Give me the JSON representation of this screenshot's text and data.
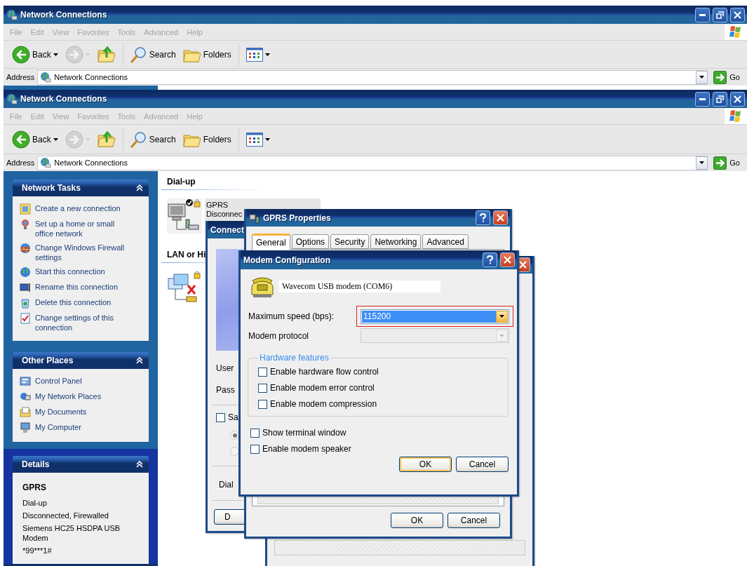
{
  "windows": [
    {
      "title": "Network Connections",
      "menu": [
        {
          "label": "File",
          "disabled": true
        },
        {
          "label": "Edit",
          "disabled": true
        },
        {
          "label": "View",
          "disabled": true
        },
        {
          "label": "Favorites",
          "disabled": true
        },
        {
          "label": "Tools",
          "disabled": true
        },
        {
          "label": "Advanced",
          "disabled": true
        },
        {
          "label": "Help",
          "disabled": true
        }
      ],
      "toolbar": [
        {
          "kind": "back",
          "label": "Back",
          "disabled": false
        },
        {
          "kind": "forward",
          "disabled": true
        },
        {
          "kind": "up",
          "disabled": false
        },
        {
          "kind": "search",
          "label": "Search",
          "disabled": false
        },
        {
          "kind": "folders",
          "label": "Folders",
          "disabled": false
        },
        {
          "kind": "views",
          "disabled": false
        }
      ],
      "address": {
        "label": "Address",
        "value": "Network Connections",
        "go": "Go"
      }
    },
    {
      "title": "Network Connections",
      "menu": [
        {
          "label": "File",
          "disabled": true
        },
        {
          "label": "Edit",
          "disabled": true
        },
        {
          "label": "View",
          "disabled": true
        },
        {
          "label": "Favorites",
          "disabled": true
        },
        {
          "label": "Tools",
          "disabled": true
        },
        {
          "label": "Advanced",
          "disabled": true
        },
        {
          "label": "Help",
          "disabled": true
        }
      ],
      "toolbar": [
        {
          "kind": "back",
          "label": "Back",
          "disabled": false
        },
        {
          "kind": "forward",
          "disabled": true
        },
        {
          "kind": "up",
          "disabled": false
        },
        {
          "kind": "search",
          "label": "Search",
          "disabled": false
        },
        {
          "kind": "folders",
          "label": "Folders",
          "disabled": false
        },
        {
          "kind": "views",
          "disabled": false
        }
      ],
      "address": {
        "label": "Address",
        "value": "Network Connections",
        "go": "Go"
      }
    }
  ],
  "sidebar": {
    "panels": [
      {
        "kind": "links",
        "title": "Network Tasks",
        "expanded": true,
        "items": [
          {
            "label": "Create a new connection"
          },
          {
            "label": "Set up a home or small office network"
          },
          {
            "label": "Change Windows Firewall settings"
          },
          {
            "label": "Start this connection"
          },
          {
            "label": "Rename this connection"
          },
          {
            "label": "Delete this connection"
          },
          {
            "label": "Change settings of this connection"
          }
        ]
      },
      {
        "kind": "links",
        "title": "Other Places",
        "expanded": true,
        "items": [
          {
            "label": "Control Panel"
          },
          {
            "label": "My Network Places"
          },
          {
            "label": "My Documents"
          },
          {
            "label": "My Computer"
          }
        ]
      },
      {
        "kind": "details",
        "title": "Details",
        "expanded": true,
        "name": "GPRS",
        "lines": [
          "Dial-up",
          "Disconnected, Firewalled",
          "Siemens HC25 HSDPA USB Modem",
          "*99***1#"
        ]
      }
    ]
  },
  "content": {
    "groups": [
      {
        "title": "Dial-up",
        "items": [
          {
            "kind": "dialup",
            "name": "GPRS",
            "status": "Disconnec",
            "selected": true
          }
        ]
      },
      {
        "title": "LAN or Hi",
        "items": [
          {
            "kind": "lan",
            "selected": false
          }
        ]
      }
    ]
  },
  "connect_dialog": {
    "title": "Connect",
    "labels": [
      "User",
      "Pass"
    ],
    "save": {
      "label": "Sa",
      "checked": false
    },
    "radios": [
      {
        "selected": true
      },
      {
        "selected": false
      }
    ],
    "dial_label": "Dial",
    "button": "D"
  },
  "properties_dialog": {
    "title": "GPRS Properties",
    "tabs": [
      {
        "label": "General",
        "selected": true
      },
      {
        "label": "Options",
        "selected": false
      },
      {
        "label": "Security",
        "selected": false
      },
      {
        "label": "Networking",
        "selected": false
      },
      {
        "label": "Advanced",
        "selected": false
      }
    ],
    "buttons": [
      {
        "label": "OK"
      },
      {
        "label": "Cancel"
      }
    ]
  },
  "modem_dialog": {
    "title": "Modem Configuration",
    "modem": "Wavecom USB modem (COM6)",
    "speed": {
      "label": "Maximum speed (bps):",
      "value": "115200",
      "annotated": true
    },
    "protocol": {
      "label": "Modem protocol",
      "disabled": true
    },
    "hardware": {
      "title": "Hardware features",
      "options": [
        {
          "label": "Enable hardware flow control",
          "checked": false
        },
        {
          "label": "Enable modem error control",
          "checked": false
        },
        {
          "label": "Enable modem compression",
          "checked": false
        }
      ]
    },
    "options": [
      {
        "label": "Show terminal window",
        "checked": false
      },
      {
        "label": "Enable modem speaker",
        "checked": false
      }
    ],
    "buttons": [
      {
        "label": "OK",
        "default": true
      },
      {
        "label": "Cancel",
        "default": false
      }
    ]
  }
}
